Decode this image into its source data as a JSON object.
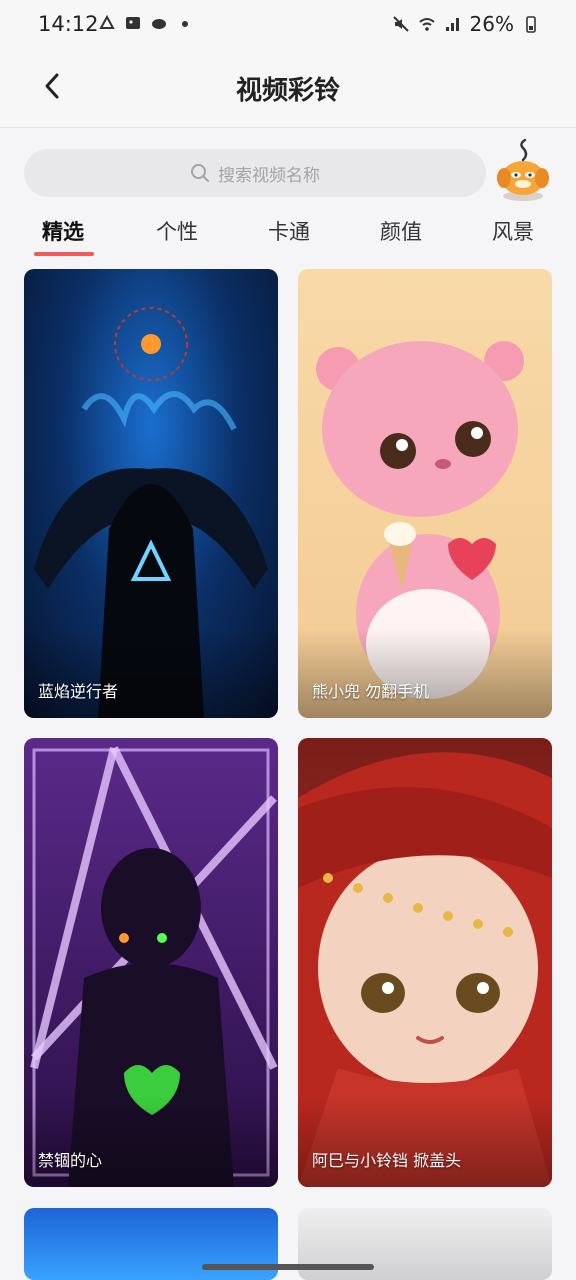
{
  "status_bar": {
    "time": "14:12",
    "battery": "26%",
    "icons": [
      "notification-icon",
      "gallery-icon",
      "cloud-icon",
      "dot-icon",
      "mute-icon",
      "wifi-icon",
      "signal-icon",
      "battery-icon"
    ]
  },
  "header": {
    "title": "视频彩铃",
    "back_icon": "chevron-left-icon"
  },
  "search": {
    "placeholder": "搜索视频名称",
    "icon": "search-icon"
  },
  "tabs": [
    {
      "label": "精选",
      "active": true
    },
    {
      "label": "个性",
      "active": false
    },
    {
      "label": "卡通",
      "active": false
    },
    {
      "label": "颜值",
      "active": false
    },
    {
      "label": "风景",
      "active": false
    }
  ],
  "videos": [
    {
      "title": "蓝焰逆行者"
    },
    {
      "title": "熊小兜 勿翻手机"
    },
    {
      "title": "禁锢的心"
    },
    {
      "title": "阿巳与小铃铛 掀盖头"
    },
    {
      "title": ""
    },
    {
      "title": ""
    }
  ],
  "colors": {
    "accent": "#f05a5a",
    "background": "#f5f5f7",
    "search_bg": "#e8e8ea"
  }
}
